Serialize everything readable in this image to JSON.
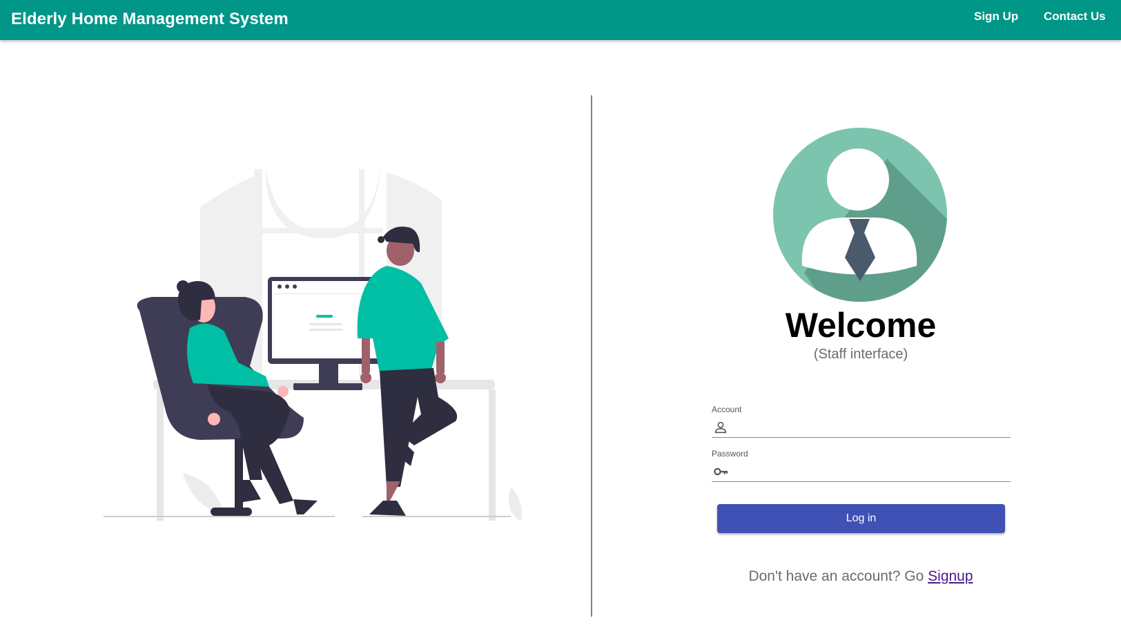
{
  "header": {
    "title": "Elderly Home Management System",
    "nav": {
      "signup": "Sign Up",
      "contact": "Contact Us"
    }
  },
  "login": {
    "welcome": "Welcome",
    "subtitle": "(Staff interface)",
    "account_label": "Account",
    "account_value": "",
    "account_icon": "person-icon",
    "password_label": "Password",
    "password_value": "",
    "password_icon": "key-icon",
    "button_label": "Log in",
    "signup_prompt": "Don't have an account? Go ",
    "signup_link": "Signup"
  },
  "colors": {
    "appbar": "#009688",
    "accent_teal": "#00bfa5",
    "avatar_circle": "#7cc4ae",
    "button": "#3f51b5",
    "link": "#4a1a8c"
  }
}
